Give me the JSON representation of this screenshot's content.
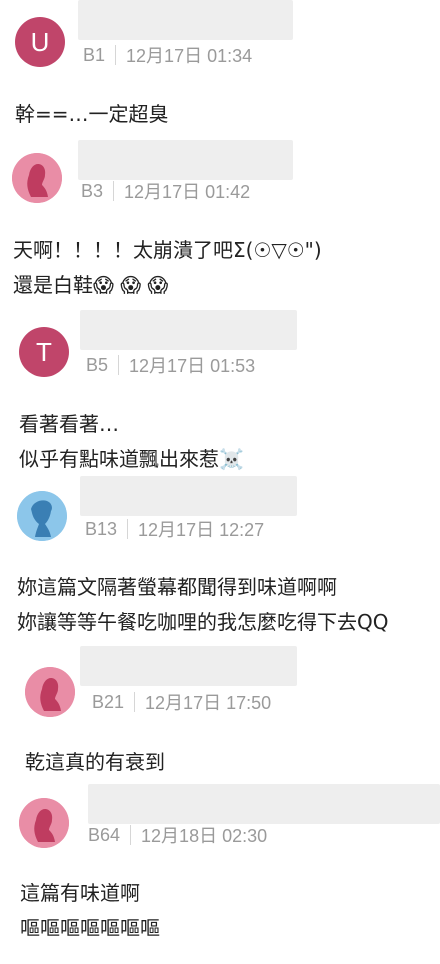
{
  "colors": {
    "avatar_red": "#c0456a",
    "avatar_pink": "#e98da6",
    "avatar_blue": "#8cc6ea",
    "meta_gray": "#9a9a9a",
    "name_bar": "#eeeeee"
  },
  "comments": [
    {
      "avatar": {
        "type": "letter",
        "letter": "U"
      },
      "floor": "B1",
      "time": "12月17日 01:34",
      "lines": [
        "幹==…一定超臭"
      ]
    },
    {
      "avatar": {
        "type": "female-silhouette-icon"
      },
      "floor": "B3",
      "time": "12月17日 01:42",
      "lines": [
        "天啊！！！！太崩潰了吧Σ(☉▽☉\")",
        "還是白鞋😱 😱 😱"
      ]
    },
    {
      "avatar": {
        "type": "letter",
        "letter": "T"
      },
      "floor": "B5",
      "time": "12月17日 01:53",
      "lines": [
        "看著看著…",
        "似乎有點味道飄出來惹☠️"
      ]
    },
    {
      "avatar": {
        "type": "male-silhouette-icon"
      },
      "floor": "B13",
      "time": "12月17日 12:27",
      "lines": [
        "妳這篇文隔著螢幕都聞得到味道啊啊",
        "妳讓等等午餐吃咖哩的我怎麼吃得下去QQ"
      ]
    },
    {
      "avatar": {
        "type": "female-silhouette-icon"
      },
      "floor": "B21",
      "time": "12月17日 17:50",
      "lines": [
        "乾這真的有衰到"
      ]
    },
    {
      "avatar": {
        "type": "female-silhouette-icon"
      },
      "floor": "B64",
      "time": "12月18日 02:30",
      "lines": [
        "這篇有味道啊",
        "嘔嘔嘔嘔嘔嘔嘔"
      ]
    }
  ]
}
